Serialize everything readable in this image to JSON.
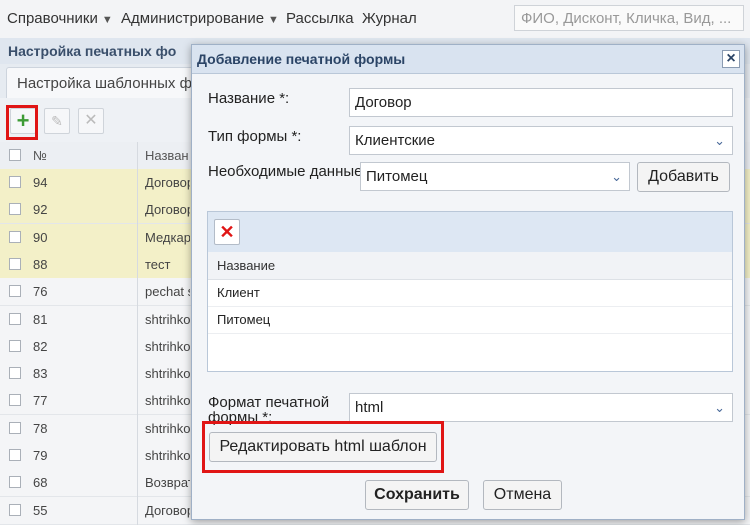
{
  "nav": {
    "items": [
      {
        "label": "Справочники",
        "caret": true
      },
      {
        "label": "Администрирование",
        "caret": true
      },
      {
        "label": "Рассылка",
        "caret": false
      },
      {
        "label": "Журнал",
        "caret": false
      }
    ],
    "search_placeholder": "ФИО, Дисконт, Кличка, Вид, ..."
  },
  "background": {
    "page_title": "Настройка печатных фо",
    "tab_label": "Настройка шаблонных фо",
    "grid": {
      "headers": {
        "num": "№",
        "name": "Назван"
      },
      "rows": [
        {
          "num": "94",
          "name": "Договор",
          "highlight": true
        },
        {
          "num": "92",
          "name": "Договор",
          "highlight": true
        },
        {
          "num": "90",
          "name": "Медкар",
          "highlight": true
        },
        {
          "num": "88",
          "name": "тест",
          "highlight": true
        },
        {
          "num": "76",
          "name": "pechat s",
          "highlight": false
        },
        {
          "num": "81",
          "name": "shtrihko",
          "highlight": false
        },
        {
          "num": "82",
          "name": "shtrihko",
          "highlight": false
        },
        {
          "num": "83",
          "name": "shtrihko",
          "highlight": false
        },
        {
          "num": "77",
          "name": "shtrihko",
          "highlight": false
        },
        {
          "num": "78",
          "name": "shtrihko",
          "highlight": false
        },
        {
          "num": "79",
          "name": "shtrihko",
          "highlight": false
        },
        {
          "num": "68",
          "name": "Возврат",
          "highlight": false
        },
        {
          "num": "55",
          "name": "Договор",
          "highlight": false
        }
      ]
    }
  },
  "dialog": {
    "title": "Добавление печатной формы",
    "name_label": "Название *:",
    "name_value": "Договор",
    "type_label": "Тип формы *:",
    "type_value": "Клиентские",
    "data_label": "Необходимые данные:",
    "data_value": "Питомец",
    "add_label": "Добавить",
    "subgrid": {
      "header": "Название",
      "rows": [
        "Клиент",
        "Питомец"
      ]
    },
    "format_label": "Формат печатной формы *:",
    "format_value": "html",
    "edit_template_label": "Редактировать html шаблон",
    "save_label": "Сохранить",
    "cancel_label": "Отмена"
  },
  "colors": {
    "highlight_border": "#e01515",
    "add_icon": "#3d9b35",
    "selected_row": "#f3f0c8"
  }
}
